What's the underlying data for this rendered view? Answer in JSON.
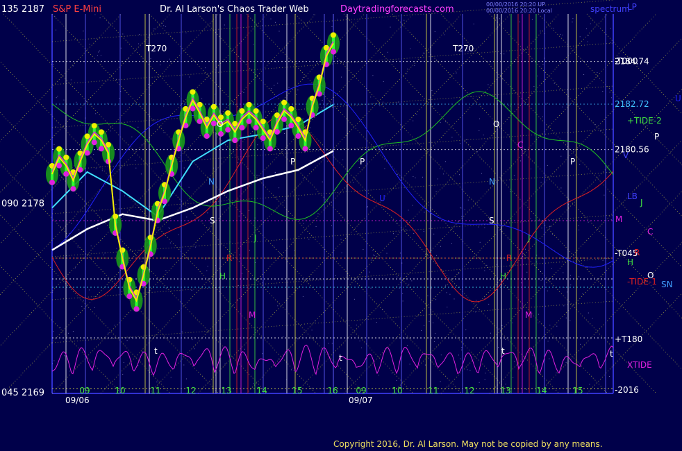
{
  "header": {
    "left_label": "135  2187",
    "product": "S&P E-Mini",
    "title": "Dr. Al Larson's Chaos Trader Web",
    "site": "Daytradingforecasts.com",
    "timestamp_line1": "00/00/2016 20:20 UP",
    "timestamp_line2": "00/00/2016 20:20 Local",
    "spectrum": "spectrum",
    "top_right": "LP"
  },
  "footer": {
    "copyright": "Copyright 2016, Dr. Al Larson. May not be copied by any means."
  },
  "colors": {
    "background": "#00004a",
    "price": "#f0f000",
    "candle_glow": "#1a9a1a",
    "magenta": "#e020e0",
    "cyan_ma": "#40e0ff",
    "white_ma": "#ffffff",
    "red": "#e02020",
    "green": "#20c020",
    "blue": "#2020ff",
    "yellow_dotted": "#e0e040"
  },
  "chart_data": {
    "type": "line",
    "title": "S&P E-Mini",
    "dates": [
      "09/06",
      "09/07"
    ],
    "hours_day1": [
      "09",
      "10",
      "11",
      "12",
      "13",
      "14",
      "15",
      "16"
    ],
    "hours_day2": [
      "09",
      "10",
      "11",
      "12",
      "13",
      "14",
      "15"
    ],
    "ylim": [
      2169,
      2187
    ],
    "left_axis": [
      "135  2187",
      "090  2178",
      "045  2169"
    ],
    "price_levels": [
      {
        "label": "2184.74",
        "value": 2184.74,
        "color": "#ffffff"
      },
      {
        "label": "2182.72",
        "value": 2182.72,
        "color": "#40c0ff"
      },
      {
        "label": "2180.56",
        "value": 2180.56,
        "color": "#ffffff"
      }
    ],
    "right_labels": [
      {
        "label": "-T000",
        "color": "#ffffff"
      },
      {
        "label": "+TIDE-2",
        "color": "#40e040"
      },
      {
        "label": "P",
        "color": "#ffffff"
      },
      {
        "label": "V",
        "color": "#4040ff"
      },
      {
        "label": "LB",
        "color": "#4040ff"
      },
      {
        "label": "J",
        "color": "#40e040"
      },
      {
        "label": "M",
        "color": "#e020e0"
      },
      {
        "label": "C",
        "color": "#e020e0"
      },
      {
        "label": "-T045",
        "color": "#ffffff"
      },
      {
        "label": "R",
        "color": "#e02020"
      },
      {
        "label": "H",
        "color": "#40e040"
      },
      {
        "label": "O",
        "color": "#ffffff"
      },
      {
        "label": "-TIDE-1",
        "color": "#e02020"
      },
      {
        "label": "SN",
        "color": "#40a0ff"
      },
      {
        "label": "+T180",
        "color": "#ffffff"
      },
      {
        "label": "XTIDE",
        "color": "#e020e0"
      },
      {
        "label": "-2016",
        "color": "#ffffff"
      },
      {
        "label": "U",
        "color": "#2020ff"
      }
    ],
    "chart_markers": [
      "T270",
      "T270",
      "N",
      "N",
      "S",
      "S",
      "O",
      "O",
      "R",
      "R",
      "H",
      "H",
      "M",
      "M",
      "P",
      "P",
      "P",
      "C",
      "U",
      "t",
      "t",
      "t",
      "t",
      "J",
      "J"
    ],
    "series": [
      {
        "name": "price",
        "x": [
          0,
          2,
          4,
          6,
          8,
          10,
          12,
          14,
          16,
          18,
          20,
          22,
          24,
          26,
          28,
          30,
          32,
          34,
          36,
          38,
          40,
          42,
          44,
          46,
          48,
          50,
          52,
          54,
          56,
          58,
          60,
          62,
          64,
          66,
          68,
          70,
          72,
          74,
          76,
          78,
          80
        ],
        "values": [
          2179.4,
          2180.2,
          2179.8,
          2179.1,
          2180.0,
          2180.8,
          2181.3,
          2181.0,
          2180.4,
          2177.0,
          2175.4,
          2174.0,
          2173.4,
          2174.6,
          2176.0,
          2177.6,
          2178.5,
          2179.8,
          2181.0,
          2182.1,
          2182.9,
          2182.3,
          2181.6,
          2182.2,
          2181.7,
          2181.9,
          2181.4,
          2182.0,
          2182.3,
          2182.0,
          2181.5,
          2181.0,
          2181.8,
          2182.4,
          2182.1,
          2181.6,
          2181.0,
          2182.6,
          2183.6,
          2185.0,
          2185.6
        ]
      },
      {
        "name": "cyan moving average",
        "x": [
          0,
          10,
          20,
          30,
          40,
          50,
          60,
          70,
          80
        ],
        "values": [
          2177.8,
          2179.5,
          2178.6,
          2177.4,
          2180.0,
          2181.0,
          2181.3,
          2181.7,
          2182.7
        ]
      },
      {
        "name": "white moving average",
        "x": [
          0,
          10,
          20,
          30,
          40,
          50,
          60,
          70,
          80
        ],
        "values": [
          2175.8,
          2176.8,
          2177.5,
          2177.2,
          2177.8,
          2178.6,
          2179.2,
          2179.6,
          2180.5
        ]
      }
    ],
    "grid": true,
    "legend": "none"
  }
}
